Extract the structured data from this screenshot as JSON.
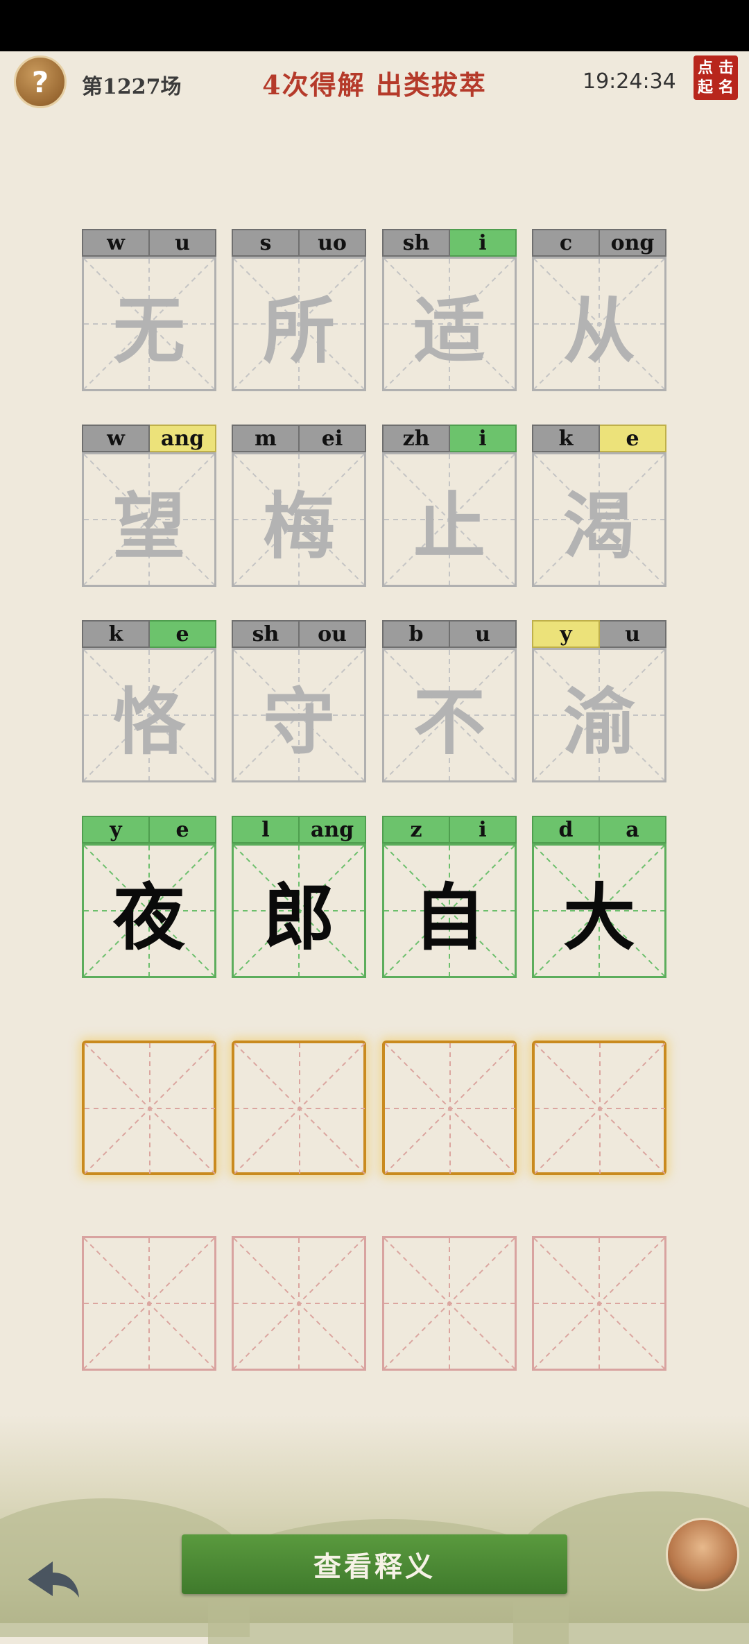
{
  "header": {
    "help_icon": "question-mark-icon",
    "help_glyph": "?",
    "round_label": "第1227场",
    "title": "4次得解  出类拔萃",
    "clock": "19:24:34",
    "seal_chars": [
      "点",
      "击",
      "起",
      "名"
    ]
  },
  "rows": [
    {
      "cells": [
        {
          "initial": "w",
          "final": "u",
          "initial_state": "gray",
          "final_state": "gray",
          "char": "无"
        },
        {
          "initial": "s",
          "final": "uo",
          "initial_state": "gray",
          "final_state": "gray",
          "char": "所"
        },
        {
          "initial": "sh",
          "final": "i",
          "initial_state": "gray",
          "final_state": "green",
          "char": "适"
        },
        {
          "initial": "c",
          "final": "ong",
          "initial_state": "gray",
          "final_state": "gray",
          "char": "从"
        }
      ]
    },
    {
      "cells": [
        {
          "initial": "w",
          "final": "ang",
          "initial_state": "gray",
          "final_state": "yellow",
          "char": "望"
        },
        {
          "initial": "m",
          "final": "ei",
          "initial_state": "gray",
          "final_state": "gray",
          "char": "梅"
        },
        {
          "initial": "zh",
          "final": "i",
          "initial_state": "gray",
          "final_state": "green",
          "char": "止"
        },
        {
          "initial": "k",
          "final": "e",
          "initial_state": "gray",
          "final_state": "yellow",
          "char": "渴"
        }
      ]
    },
    {
      "cells": [
        {
          "initial": "k",
          "final": "e",
          "initial_state": "gray",
          "final_state": "green",
          "char": "恪"
        },
        {
          "initial": "sh",
          "final": "ou",
          "initial_state": "gray",
          "final_state": "gray",
          "char": "守"
        },
        {
          "initial": "b",
          "final": "u",
          "initial_state": "gray",
          "final_state": "gray",
          "char": "不"
        },
        {
          "initial": "y",
          "final": "u",
          "initial_state": "yellow",
          "final_state": "gray",
          "char": "渝"
        }
      ]
    },
    {
      "cells": [
        {
          "initial": "y",
          "final": "e",
          "initial_state": "green",
          "final_state": "green",
          "char": "夜"
        },
        {
          "initial": "l",
          "final": "ang",
          "initial_state": "green",
          "final_state": "green",
          "char": "郎"
        },
        {
          "initial": "z",
          "final": "i",
          "initial_state": "green",
          "final_state": "green",
          "char": "自"
        },
        {
          "initial": "d",
          "final": "a",
          "initial_state": "green",
          "final_state": "green",
          "char": "大"
        }
      ]
    }
  ],
  "footer": {
    "back_icon": "back-arrow-icon",
    "explain_button": "查看释义",
    "avatar_icon": "sage-avatar-icon"
  },
  "colors": {
    "green": "#6cc36c",
    "yellow": "#ece27a",
    "gray": "#9c9c9c",
    "accent_red": "#b53a2a",
    "input_border": "#c98a1e"
  }
}
